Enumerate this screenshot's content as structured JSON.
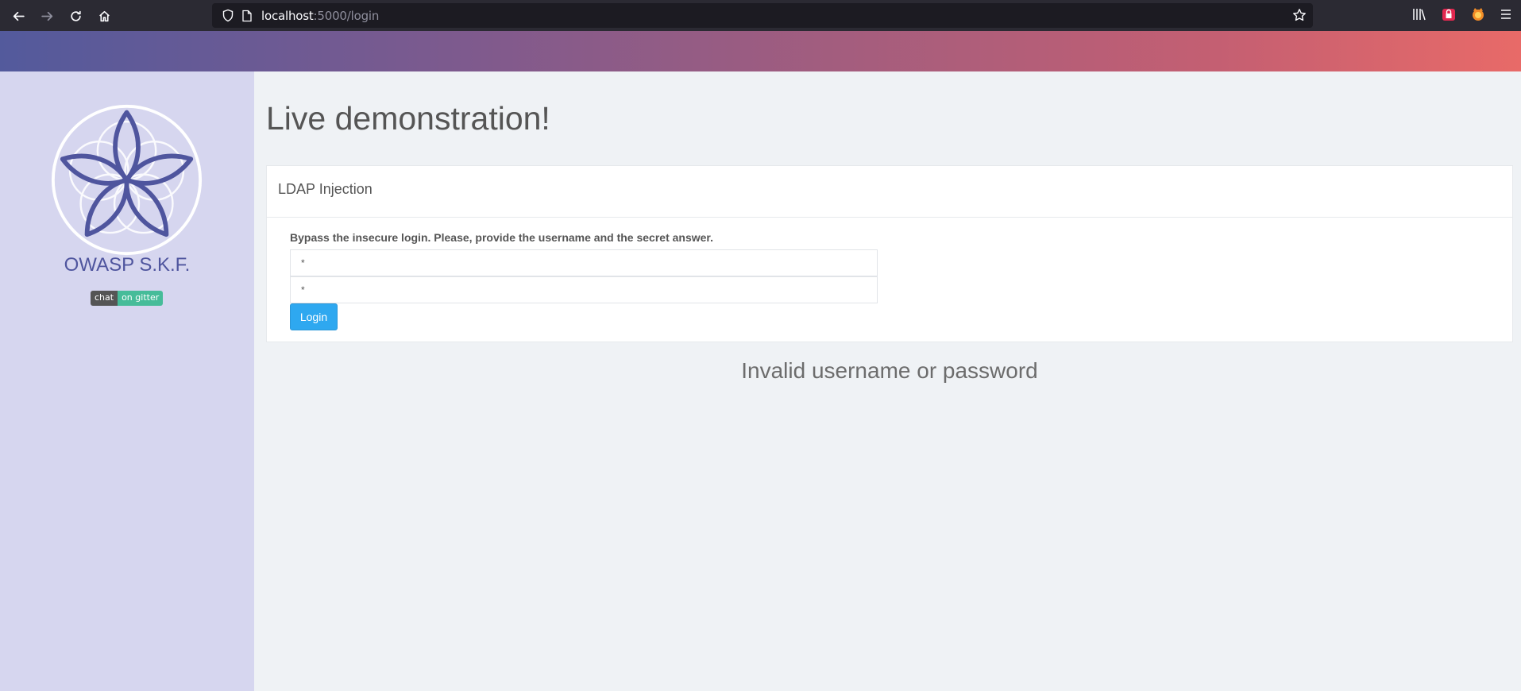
{
  "browser": {
    "url_host": "localhost",
    "url_path": ":5000/login"
  },
  "sidebar": {
    "brand": "OWASP S.K.F.",
    "badge_left": "chat",
    "badge_right": "on gitter"
  },
  "main": {
    "title": "Live demonstration!",
    "card_title": "LDAP Injection",
    "instruction": "Bypass the insecure login. Please, provide the username and the secret answer.",
    "username_value": "*",
    "answer_value": "*",
    "login_label": "Login",
    "error_message": "Invalid username or password"
  },
  "colors": {
    "accent": "#2ea8f0",
    "brand": "#4f559e",
    "sidebar_bg": "#d6d6ef",
    "gradient_start": "#535a9c",
    "gradient_end": "#e86a68"
  }
}
